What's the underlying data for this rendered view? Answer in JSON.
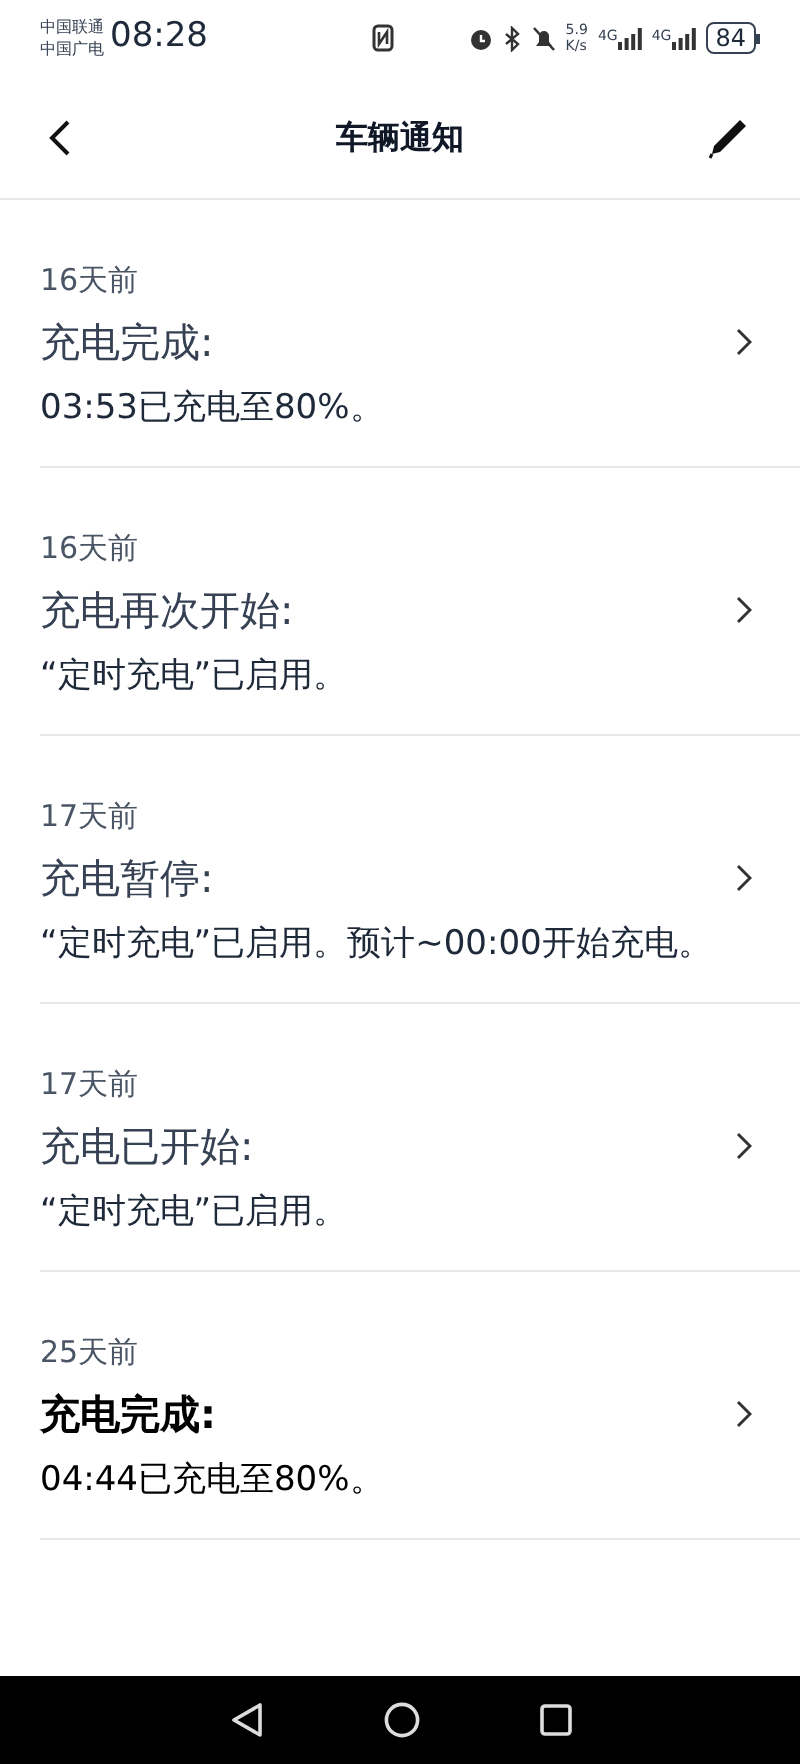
{
  "status_bar": {
    "carriers": [
      "中国联通",
      "中国广电"
    ],
    "time": "08:28",
    "net_speed": [
      "5.9",
      "K/s"
    ],
    "sim_labels": [
      "4G",
      "4G"
    ],
    "battery": "84"
  },
  "header": {
    "title": "车辆通知"
  },
  "notifications": [
    {
      "time": "16天前",
      "title": "充电完成:",
      "body": "03:53已充电至80%。",
      "unread": false
    },
    {
      "time": "16天前",
      "title": "充电再次开始:",
      "body": "“定时充电”已启用。",
      "unread": false
    },
    {
      "time": "17天前",
      "title": "充电暂停:",
      "body": "“定时充电”已启用。预计~00:00开始充电。",
      "unread": false
    },
    {
      "time": "17天前",
      "title": "充电已开始:",
      "body": "“定时充电”已启用。",
      "unread": false
    },
    {
      "time": "25天前",
      "title": "充电完成:",
      "body": "04:44已充电至80%。",
      "unread": true
    }
  ]
}
